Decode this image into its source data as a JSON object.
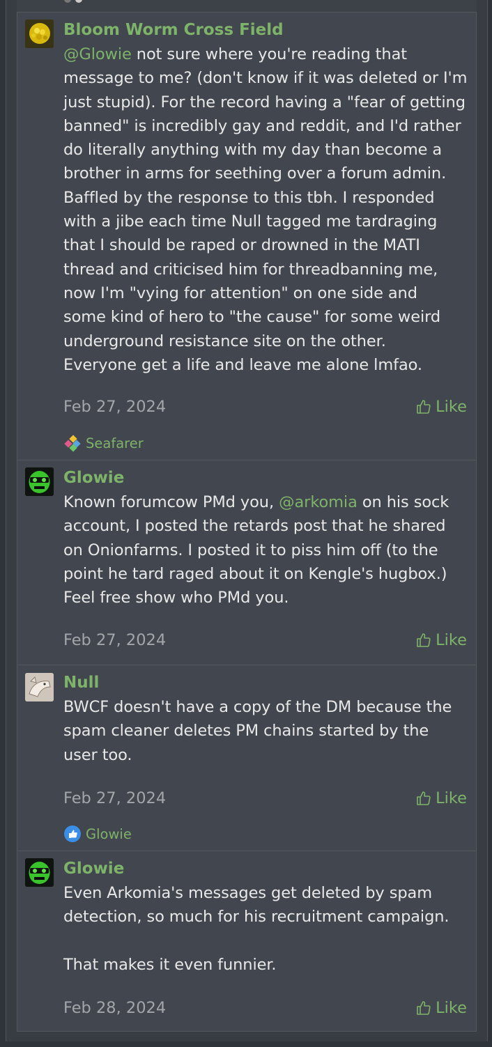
{
  "posts": [
    {
      "username": "Bloom Worm Cross Field",
      "mention": "@Glowie",
      "lines": [
        " not sure where you're reading that",
        "message to me? (don't know if it was deleted or I'm",
        "just stupid). For the record having a \"fear of getting",
        "banned\" is incredibly gay and reddit, and I'd rather",
        "do literally anything with my day than become a",
        "brother in arms for seething over a forum admin.",
        "Baffled by the response to this tbh. I responded",
        "with a jibe each time Null tagged me tardraging",
        "that I should be raped or drowned in the MATI",
        "thread and criticised him for threadbanning me,",
        "now I'm \"vying for attention\" on one side and",
        "some kind of hero to \"the cause\" for some weird",
        "underground resistance site on the other.",
        "Everyone get a life and leave me alone lmfao."
      ],
      "date": "Feb 27, 2024",
      "like_label": "Like",
      "reaction_user": "Seafarer"
    },
    {
      "username": "Glowie",
      "line1_pre": "Known forumcow PMd you, ",
      "line1_mention": "@arkomia",
      "line1_post": " on his sock",
      "lines": [
        "account, I posted the retards post that he shared",
        "on Onionfarms. I posted it to piss him off (to the",
        "point he tard raged about it on Kengle's hugbox.)",
        "Feel free show who PMd you."
      ],
      "date": "Feb 27, 2024",
      "like_label": "Like"
    },
    {
      "username": "Null",
      "lines": [
        "BWCF doesn't have a copy of the DM because the",
        "spam cleaner deletes PM chains started by the",
        "user too."
      ],
      "date": "Feb 27, 2024",
      "like_label": "Like",
      "reaction_user": "Glowie"
    },
    {
      "username": "Glowie",
      "lines": [
        "Even Arkomia's messages get deleted by spam",
        "detection, so much for his recruitment campaign."
      ],
      "line_after_gap": "That makes it even funnier.",
      "date": "Feb 28, 2024",
      "like_label": "Like"
    }
  ],
  "colors": {
    "accent": "#7eb36a",
    "background": "#42464e",
    "text": "#e8e8e8",
    "muted": "#a3a6ab"
  }
}
